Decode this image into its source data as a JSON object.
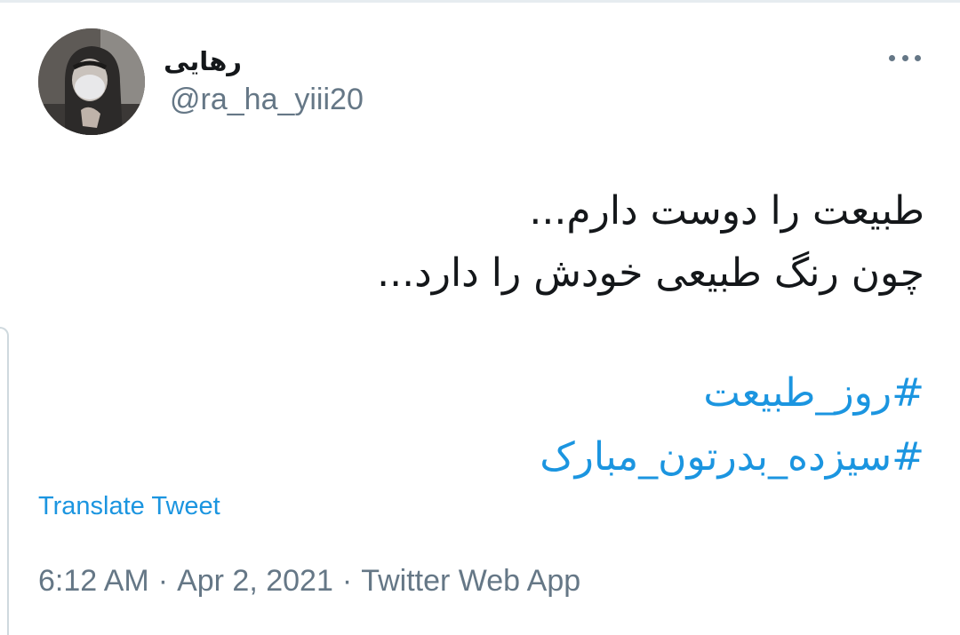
{
  "author": {
    "display_name": "رهایی",
    "handle": "@ra_ha_yiii20",
    "avatar": "profile-photo"
  },
  "more_icon": "more-horizontal-icon",
  "tweet": {
    "lines": [
      "طبیعت را دوست دارم...",
      "چون رنگ طبیعی خودش را دارد..."
    ],
    "hashtags": [
      "#روز_طبیعت",
      "#سیزده_بدرتون_مبارک"
    ]
  },
  "translate_label": "Translate Tweet",
  "meta": {
    "time": "6:12 AM",
    "separator": "·",
    "date": "Apr 2, 2021",
    "source": "Twitter Web App"
  },
  "colors": {
    "link": "#1b95e0",
    "secondary_text": "#657786",
    "primary_text": "#14171a"
  }
}
